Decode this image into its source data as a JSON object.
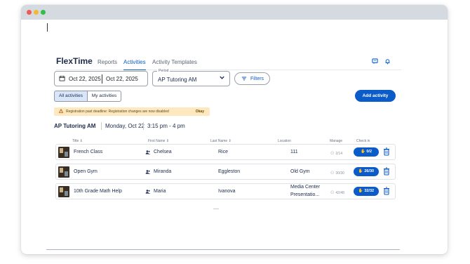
{
  "window": {
    "controls": [
      "close",
      "minimize",
      "maximize"
    ]
  },
  "nav": {
    "brand": "FlexTime",
    "links": [
      "Reports",
      "Activities",
      "Activity Templates"
    ],
    "active": "Activities",
    "icons": [
      "message-icon",
      "bell-icon"
    ]
  },
  "filters": {
    "date_start": "Oct 22, 2025",
    "date_end": "Oct 22, 2025",
    "period_label": "Period",
    "period_value": "AP Tutoring AM",
    "filters_label": "Filters"
  },
  "toggle": {
    "all": "All activities",
    "mine": "My activities"
  },
  "add_button": "Add activity",
  "banner": {
    "message": "Registration past deadline: Registration changes are now disabled",
    "action": "Okay"
  },
  "heading": {
    "title": "AP Tutoring AM",
    "date": "Monday, Oct 22",
    "time": "3:15 pm - 4 pm"
  },
  "columns": {
    "title": "Title",
    "first_name": "First Name",
    "last_name": "Last Name",
    "location": "Location",
    "manage": "Manage",
    "check_in": "Check in"
  },
  "rows": [
    {
      "title": "French Class",
      "first": "Chelsea",
      "last": "Rice",
      "location": "111",
      "location2": "",
      "manage": "2/14",
      "check": "0/2"
    },
    {
      "title": "Open Gym",
      "first": "Miranda",
      "last": "Eggleston",
      "location": "Old Gym",
      "location2": "",
      "manage": "30/30",
      "check": "26/30"
    },
    {
      "title": "10th Grade Math Help",
      "first": "Maria",
      "last": "Ivanova",
      "location": "Media Center",
      "location2": "Presentatio...",
      "manage": "42/48",
      "check": "32/32"
    }
  ],
  "colors": {
    "accent": "#0b5cc9",
    "banner": "#fde8bf",
    "brand": "#1c2b4a"
  }
}
